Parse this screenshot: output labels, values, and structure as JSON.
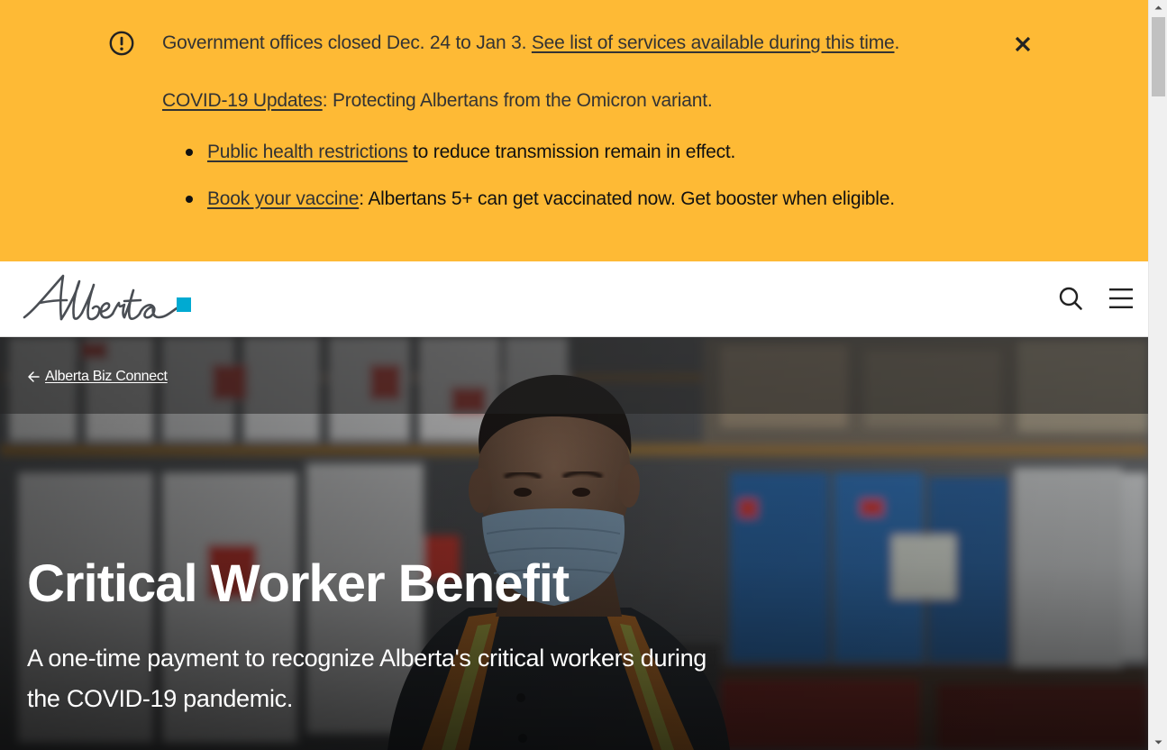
{
  "alert": {
    "icon": "exclamation-circle-icon",
    "close_icon": "close-x-icon",
    "line1_text": "Government offices closed Dec. 24 to Jan 3. ",
    "line1_link": "See list of services available during this time",
    "line1_end": ".",
    "covid_link": "COVID-19 Updates",
    "covid_text": ": Protecting Albertans from the Omicron variant.",
    "bullets": [
      {
        "link": "Public health restrictions",
        "text": " to reduce transmission remain in effect."
      },
      {
        "link": "Book your vaccine",
        "text": ": Albertans 5+ can get vaccinated now. Get booster when eligible."
      }
    ],
    "color": "#feba35"
  },
  "header": {
    "logo_text": "Alberta",
    "logo_accent_color": "#00aad2",
    "search_icon": "search-icon",
    "menu_icon": "hamburger-menu-icon"
  },
  "hero": {
    "breadcrumb_icon": "arrow-left-icon",
    "breadcrumb_link": "Alberta Biz Connect",
    "title": "Critical Worker Benefit",
    "subtitle": "A one-time payment to recognize Alberta's critical workers during the COVID-19 pandemic."
  }
}
